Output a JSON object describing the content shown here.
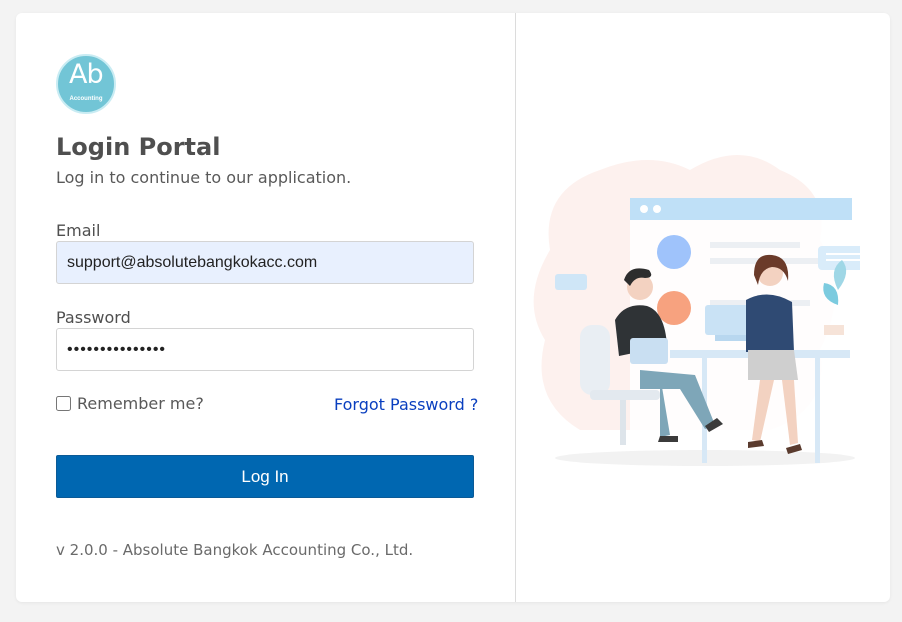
{
  "logo": {
    "letters": "Ab",
    "caption": "Accounting"
  },
  "login": {
    "title": "Login Portal",
    "subtitle": "Log in to continue to our application.",
    "email_label": "Email",
    "email_value": "support@absolutebangkokacc.com",
    "password_label": "Password",
    "password_value": "•••••••••••••••",
    "remember_label": "Remember me?",
    "remember_checked": false,
    "forgot_link": "Forgot Password ?",
    "submit_label": "Log In"
  },
  "footer": {
    "version_text": "v 2.0.0 - Absolute Bangkok Accounting Co., Ltd."
  },
  "colors": {
    "accent": "#0067b1",
    "link": "#0a3fbf",
    "logo_bg": "#72c5d6"
  }
}
